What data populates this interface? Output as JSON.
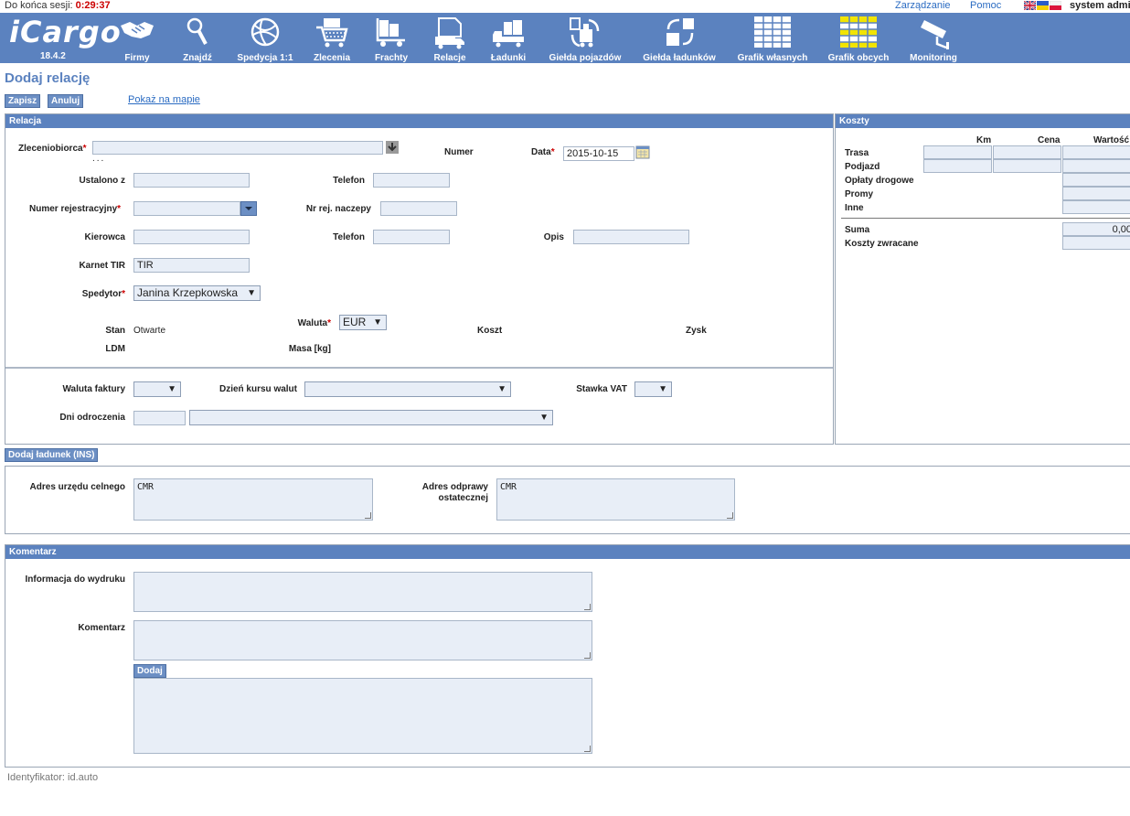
{
  "topbar": {
    "session_label": "Do końca sesji:",
    "session_time": "0:29:37",
    "link_manage": "Zarządzanie",
    "link_help": "Pomoc",
    "user": "system admi"
  },
  "logo": {
    "word": "iCargo",
    "version": "18.4.2"
  },
  "nav": {
    "firmy": "Firmy",
    "znajdz": "Znajdź",
    "spedycja": "Spedycja 1:1",
    "zlecenia": "Zlecenia",
    "frachty": "Frachty",
    "relacje": "Relacje",
    "ladunki": "Ładunki",
    "gielda_pojazdow": "Giełda pojazdów",
    "gielda_ladunkow": "Giełda ładunków",
    "grafik_wlasnych": "Grafik własnych",
    "grafik_obcych": "Grafik obcych",
    "monitoring": "Monitoring"
  },
  "page": {
    "title": "Dodaj relację",
    "save": "Zapisz",
    "cancel": "Anuluj",
    "map_link": "Pokaż na mapie"
  },
  "relacja": {
    "header": "Relacja",
    "zleceniobiorca": "Zleceniobiorca",
    "dots": "...",
    "numer": "Numer",
    "data": "Data",
    "data_value": "2015-10-15",
    "ustalono": "Ustalono z",
    "telefon": "Telefon",
    "numer_rej": "Numer rejestracyjny",
    "nr_naczepy": "Nr rej. naczepy",
    "kierowca": "Kierowca",
    "telefon2": "Telefon",
    "opis": "Opis",
    "karnet": "Karnet TIR",
    "karnet_value": "TIR",
    "spedytor": "Spedytor",
    "spedytor_value": "Janina Krzepkowska",
    "stan": "Stan",
    "stan_value": "Otwarte",
    "waluta": "Waluta",
    "waluta_value": "EUR",
    "koszt": "Koszt",
    "zysk": "Zysk",
    "ldm": "LDM",
    "masa": "Masa [kg]",
    "waluta_faktury": "Waluta faktury",
    "dzien_kursu": "Dzień kursu walut",
    "stawka_vat": "Stawka VAT",
    "dni_odroczenia": "Dni odroczenia"
  },
  "koszty": {
    "header": "Koszty",
    "col_km": "Km",
    "col_cena": "Cena",
    "col_wartosc": "Wartość",
    "rows": [
      "Trasa",
      "Podjazd",
      "Opłaty drogowe",
      "Promy",
      "Inne"
    ],
    "suma": "Suma",
    "suma_value": "0,00",
    "zwracane": "Koszty zwracane"
  },
  "ladunek": {
    "button": "Dodaj ładunek (INS)",
    "urzad": "Adres urzędu celnego",
    "urzad_value": "CMR",
    "odprawa1": "Adres odprawy",
    "odprawa2": "ostatecznej",
    "odprawa_value": "CMR"
  },
  "komentarz": {
    "header": "Komentarz",
    "info": "Informacja do wydruku",
    "komentarz": "Komentarz",
    "dodaj": "Dodaj"
  },
  "footer": {
    "id": "Identyfikator: id.auto"
  },
  "colors": {
    "nav": "#5b82bf",
    "input_bg": "#e8eef7",
    "required": "#cc0000"
  }
}
